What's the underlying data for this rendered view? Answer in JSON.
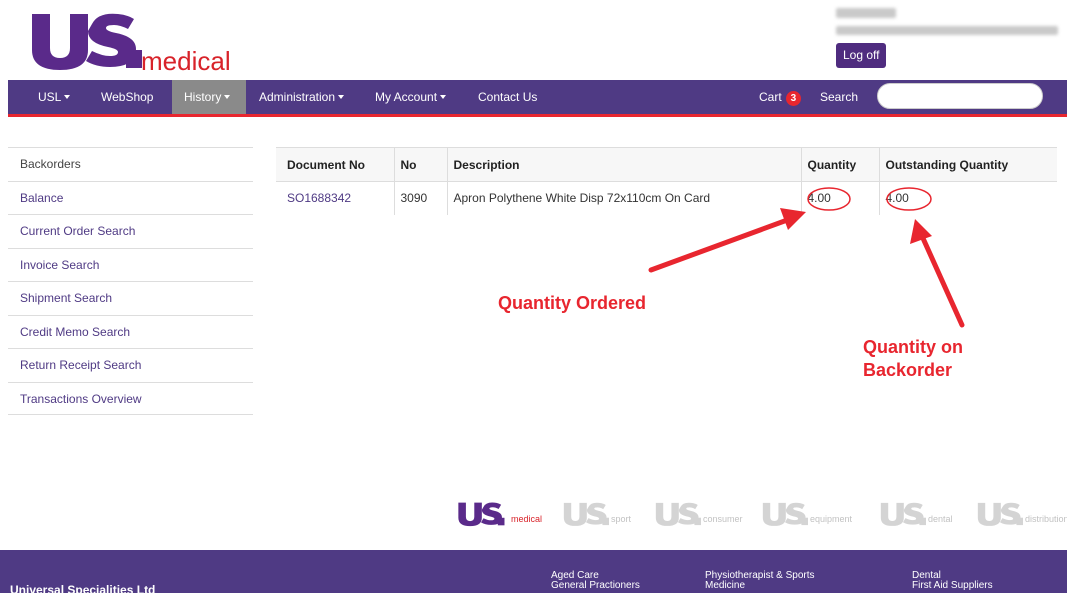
{
  "header": {
    "logo_text": "medical",
    "logoff_label": "Log off"
  },
  "nav": {
    "items": [
      {
        "label": "USL",
        "has_caret": true
      },
      {
        "label": "WebShop",
        "has_caret": false
      },
      {
        "label": "History",
        "has_caret": true
      },
      {
        "label": "Administration",
        "has_caret": true
      },
      {
        "label": "My Account",
        "has_caret": true
      },
      {
        "label": "Contact Us",
        "has_caret": false
      }
    ],
    "cart_label": "Cart",
    "cart_count": "3",
    "search_label": "Search",
    "search_value": ""
  },
  "sidebar": {
    "items": [
      {
        "label": "Backorders"
      },
      {
        "label": "Balance"
      },
      {
        "label": "Current Order Search"
      },
      {
        "label": "Invoice Search"
      },
      {
        "label": "Shipment Search"
      },
      {
        "label": "Credit Memo Search"
      },
      {
        "label": "Return Receipt Search"
      },
      {
        "label": "Transactions Overview"
      }
    ]
  },
  "table": {
    "headers": [
      "Document No",
      "No",
      "Description",
      "Quantity",
      "Outstanding Quantity"
    ],
    "rows": [
      {
        "document_no": "SO1688342",
        "no": "3090",
        "description": "Apron Polythene White Disp 72x110cm On Card",
        "quantity": "4.00",
        "outstanding_quantity": "4.00"
      }
    ]
  },
  "annotations": {
    "quantity_ordered": "Quantity Ordered",
    "quantity_backorder_line1": "Quantity on",
    "quantity_backorder_line2": "Backorder",
    "color": "#e8262f"
  },
  "brands": [
    {
      "name": "medical",
      "color": "#5a2a8a",
      "text_color": "#d8232a"
    },
    {
      "name": "sport",
      "color": "#d4d4d4",
      "text_color": "#c2c2c2"
    },
    {
      "name": "consumer",
      "color": "#d4d4d4",
      "text_color": "#c2c2c2"
    },
    {
      "name": "equipment",
      "color": "#d4d4d4",
      "text_color": "#c2c2c2"
    },
    {
      "name": "dental",
      "color": "#d4d4d4",
      "text_color": "#c2c2c2"
    },
    {
      "name": "distribution",
      "color": "#d4d4d4",
      "text_color": "#c2c2c2"
    }
  ],
  "footer": {
    "company": "Universal Specialities Ltd",
    "col1": [
      "Aged Care",
      "General Practioners"
    ],
    "col2": [
      "Physiotherapist & Sports",
      "Medicine"
    ],
    "col3": [
      "Dental",
      "First Aid Suppliers"
    ]
  },
  "colors": {
    "brand_purple": "#4f3a84",
    "accent_red": "#e8262f",
    "active_nav": "#8a8a8a"
  }
}
